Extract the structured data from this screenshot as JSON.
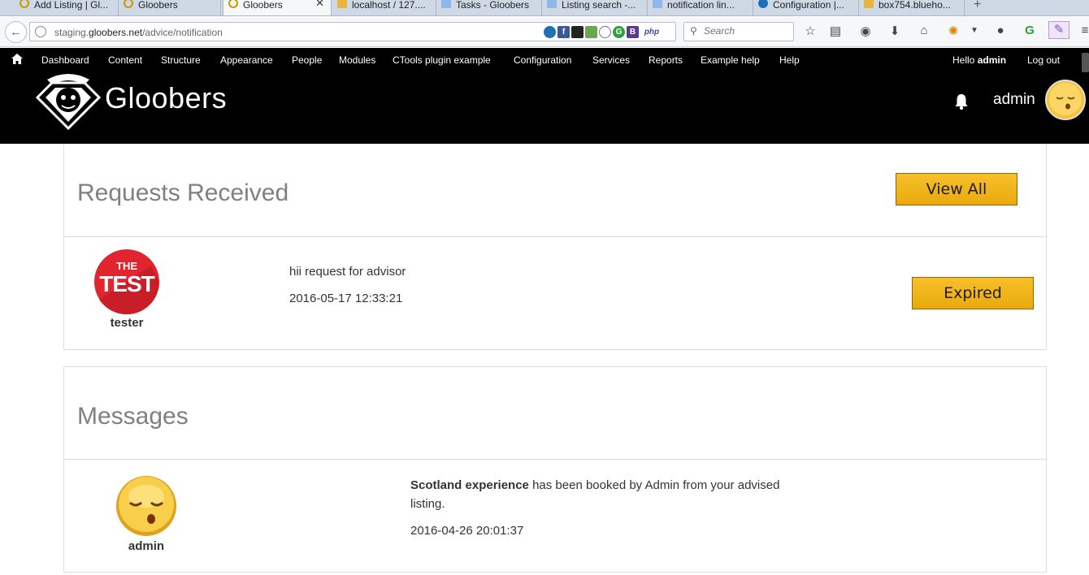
{
  "browser": {
    "tabs": [
      {
        "label": "Add Listing | Gl...",
        "favicon": "gloobers-icon"
      },
      {
        "label": "Gloobers",
        "favicon": "gloobers-icon"
      },
      {
        "label": "Gloobers",
        "favicon": "gloobers-icon",
        "active": true
      },
      {
        "label": "localhost / 127....",
        "favicon": "phpmyadmin-icon"
      },
      {
        "label": "Tasks - Gloobers",
        "favicon": "network-icon"
      },
      {
        "label": "Listing search -...",
        "favicon": "network-icon"
      },
      {
        "label": "notification lin...",
        "favicon": "network-icon"
      },
      {
        "label": "Configuration |...",
        "favicon": "drupal-icon"
      },
      {
        "label": "box754.blueho...",
        "favicon": "phpmyadmin-icon"
      }
    ],
    "url_prefix": "staging.",
    "url_domain": "gloobers.net",
    "url_path": "/advice/notification",
    "search_placeholder": "Search"
  },
  "adminbar": {
    "menu": [
      "Dashboard",
      "Content",
      "Structure",
      "Appearance",
      "People",
      "Modules",
      "CTools plugin example",
      "Configuration",
      "Services",
      "Reports",
      "Example help",
      "Help"
    ],
    "hello_prefix": "Hello ",
    "hello_user": "admin",
    "logout": "Log out"
  },
  "header": {
    "site_name": "Gloobers",
    "username": "admin"
  },
  "requests": {
    "title": "Requests Received",
    "view_all": "View All",
    "items": [
      {
        "avatar_text_top": "THE",
        "avatar_text_main": "TEST",
        "name": "tester",
        "message": "hii request for advisor",
        "date": "2016-05-17 12:33:21",
        "status": "Expired"
      }
    ]
  },
  "messages": {
    "title": "Messages",
    "items": [
      {
        "name": "admin",
        "listing": "Scotland experience",
        "message_rest": " has been booked by Admin from your advised listing.",
        "date": "2016-04-26 20:01:37"
      }
    ]
  },
  "colors": {
    "button_gold": "#f2b61a",
    "header_bg": "#000000",
    "title_grey": "#808080",
    "test_badge_red": "#e0252f"
  }
}
